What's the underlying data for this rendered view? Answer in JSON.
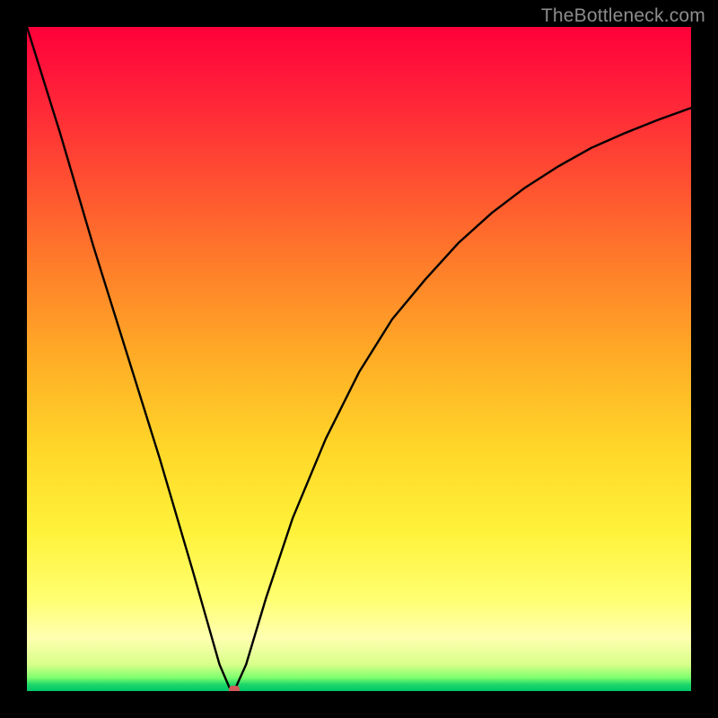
{
  "watermark": "TheBottleneck.com",
  "colors": {
    "black": "#000000",
    "watermark": "#8c8c8c",
    "curve": "#000000",
    "marker": "#cf5a59",
    "grad_top": "#ff003a",
    "grad_orange": "#ff7a2a",
    "grad_yellow": "#ffd829",
    "grad_green": "#00c76a"
  },
  "chart_data": {
    "type": "line",
    "title": "",
    "xlabel": "",
    "ylabel": "",
    "xlim": [
      0,
      100
    ],
    "ylim": [
      0,
      100
    ],
    "x": [
      0,
      5,
      10,
      15,
      20,
      25,
      27,
      29,
      30.5,
      31.2,
      33,
      36,
      40,
      45,
      50,
      55,
      60,
      65,
      70,
      75,
      80,
      85,
      90,
      95,
      100
    ],
    "y": [
      100,
      84,
      67,
      51,
      35,
      18,
      11,
      4,
      0.5,
      0,
      4,
      14,
      26,
      38,
      48,
      56,
      62,
      67.5,
      72,
      75.8,
      79,
      81.8,
      84,
      86,
      87.8
    ],
    "marker_point": {
      "x": 31.2,
      "y": 0
    },
    "series": [
      {
        "name": "bottleneck-curve",
        "x_key": "x",
        "y_key": "y"
      }
    ]
  }
}
